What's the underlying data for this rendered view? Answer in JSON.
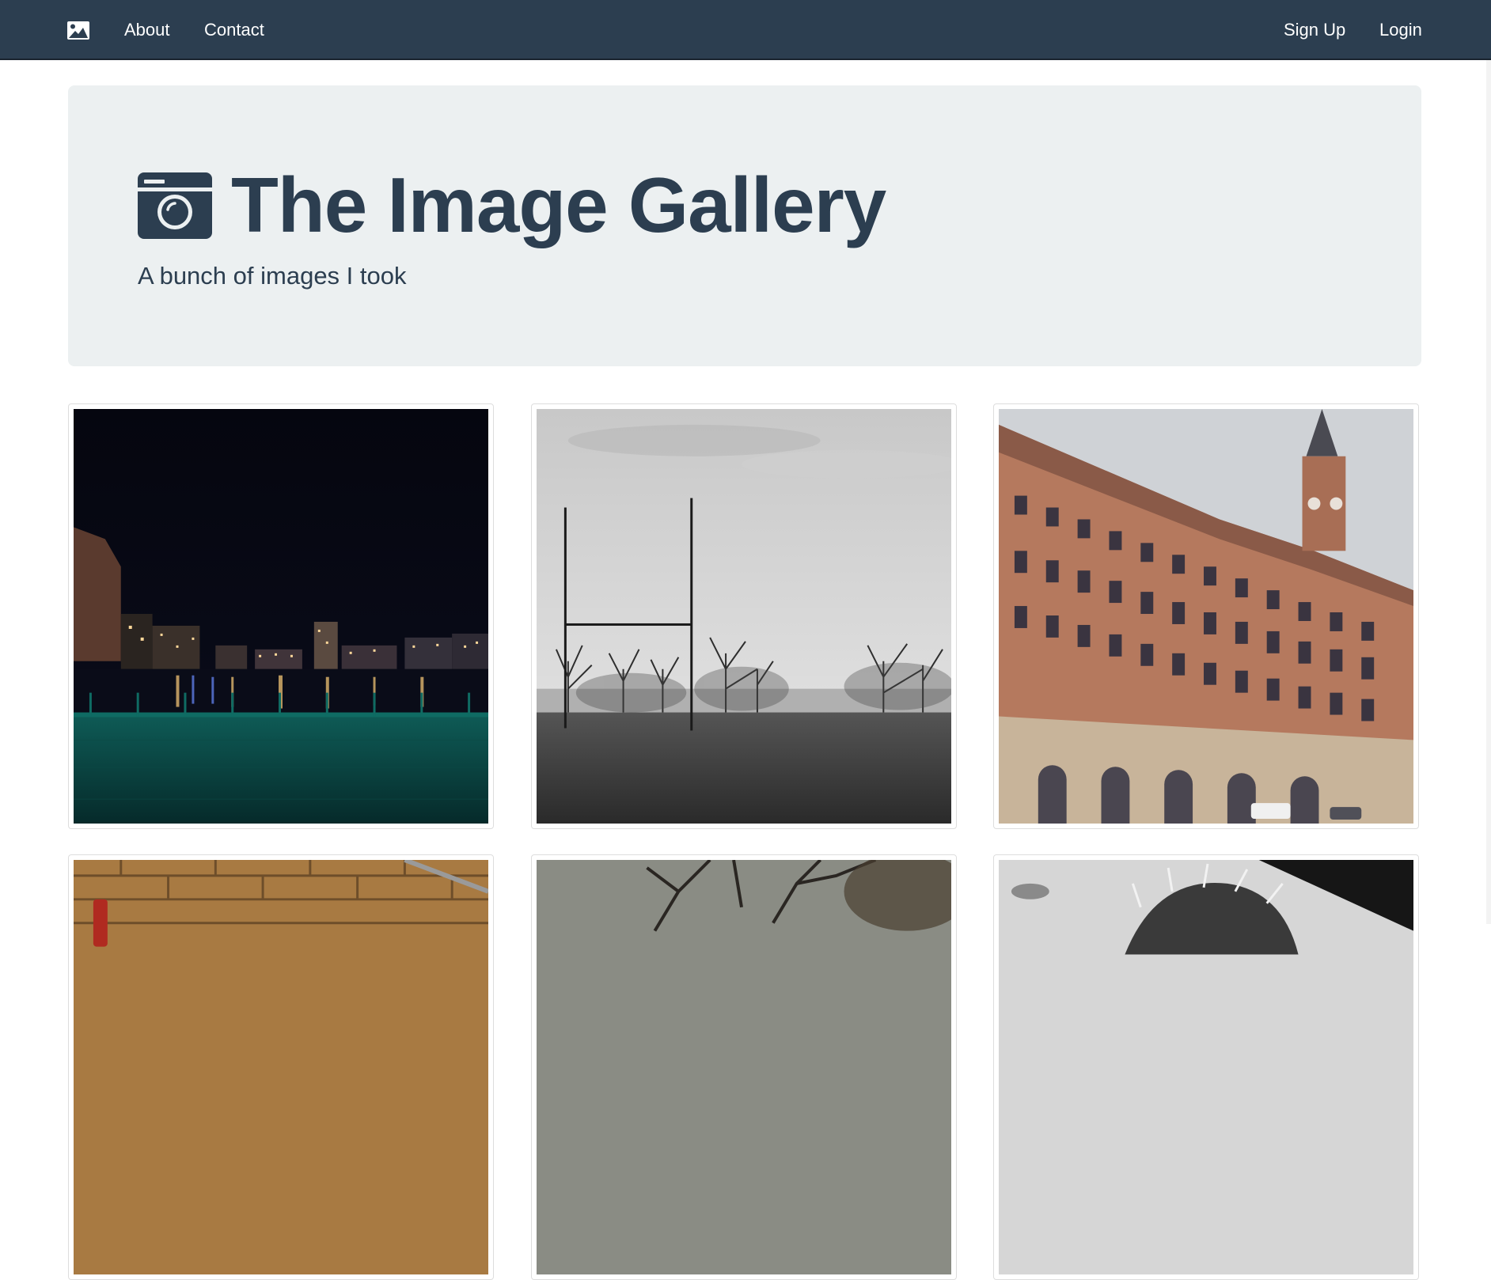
{
  "navbar": {
    "brand_icon": "image-icon",
    "links_left": [
      "About",
      "Contact"
    ],
    "links_right": [
      "Sign Up",
      "Login"
    ]
  },
  "jumbotron": {
    "icon": "camera-icon",
    "title": "The Image Gallery",
    "subtitle": "A bunch of images I took"
  },
  "gallery": {
    "images": [
      "night-city-riverwalk-photo",
      "rugby-goalpost-field-photo",
      "city-hall-clock-tower-photo",
      "brick-wall-photo",
      "bare-tree-sky-photo",
      "person-portrait-photo"
    ]
  },
  "colors": {
    "primary": "#2c3e50",
    "jumbotron_bg": "#ecf0f1"
  }
}
